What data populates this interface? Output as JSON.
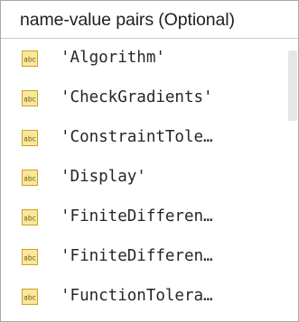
{
  "popup": {
    "header_title": "name-value pairs (Optional)"
  },
  "items": [
    {
      "label": "'Algorithm'",
      "icon": "abc-string-icon"
    },
    {
      "label": "'CheckGradients'",
      "icon": "abc-string-icon"
    },
    {
      "label": "'ConstraintTole…",
      "icon": "abc-string-icon"
    },
    {
      "label": "'Display'",
      "icon": "abc-string-icon"
    },
    {
      "label": "'FiniteDifferen…",
      "icon": "abc-string-icon"
    },
    {
      "label": "'FiniteDifferen…",
      "icon": "abc-string-icon"
    },
    {
      "label": "'FunctionTolera…",
      "icon": "abc-string-icon"
    }
  ],
  "colors": {
    "icon_fill": "#fbe79a",
    "icon_border": "#c9a227",
    "icon_text": "#6a5a1c"
  }
}
